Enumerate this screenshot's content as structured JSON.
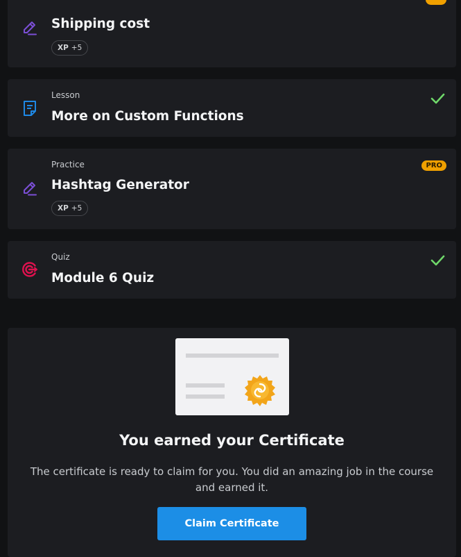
{
  "items": [
    {
      "kind": "",
      "title": "Shipping cost",
      "xp_label": "XP",
      "xp_value": "+5",
      "icon": "pencil-icon"
    },
    {
      "kind": "Lesson",
      "title": "More on Custom Functions",
      "icon": "document-icon",
      "completed": true
    },
    {
      "kind": "Practice",
      "title": "Hashtag Generator",
      "xp_label": "XP",
      "xp_value": "+5",
      "badge": "PRO",
      "icon": "pencil-icon"
    },
    {
      "kind": "Quiz",
      "title": "Module 6 Quiz",
      "icon": "target-icon",
      "completed": true
    }
  ],
  "certificate": {
    "title": "You earned your Certificate",
    "description": "The certificate is ready to claim for you. You did an amazing job in the course and earned it.",
    "button_label": "Claim Certificate"
  },
  "colors": {
    "background": "#111214",
    "card": "#1c1d21",
    "pencil_icon": "#7b4fd6",
    "document_icon": "#1e88e5",
    "target_icon": "#e0114f",
    "check": "#6fd86a",
    "pro_badge": "#f0a000",
    "button": "#1c8ee6",
    "seal": "#f2a51a"
  }
}
